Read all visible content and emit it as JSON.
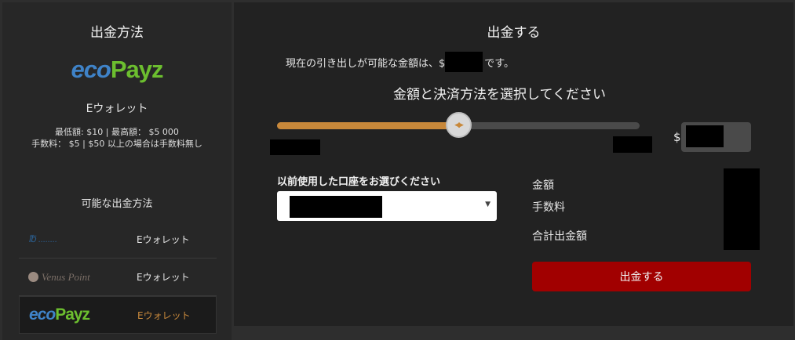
{
  "left": {
    "title": "出金方法",
    "logo": {
      "eco": "eco",
      "payz": "Payz"
    },
    "method_type": "Eウォレット",
    "limits_line1": "最低額: $10 | 最高額： $5 000",
    "limits_line2": "手数料： $5 | $50 以上の場合は手数料無し",
    "available_title": "可能な出金方法",
    "methods": [
      {
        "logo_text": "℔ ........",
        "label": "Eウォレット"
      },
      {
        "logo_text": "Venus Point",
        "label": "Eウォレット"
      },
      {
        "logo_eco": "eco",
        "logo_payz": "Payz",
        "label": "Eウォレット"
      }
    ]
  },
  "right": {
    "title": "出金する",
    "available_prefix": "現在の引き出しが可能な金額は、$",
    "available_suffix": "です。",
    "select_title": "金額と決済方法を選択してください",
    "slider": {
      "value_fraction": 0.5
    },
    "currency_symbol": "$",
    "account_title": "以前使用した口座をお選びください",
    "caret": "▼",
    "summary": {
      "amount_label": "金額",
      "fee_label": "手数料",
      "total_label": "合計出金額"
    },
    "withdraw_button": "出金する"
  }
}
